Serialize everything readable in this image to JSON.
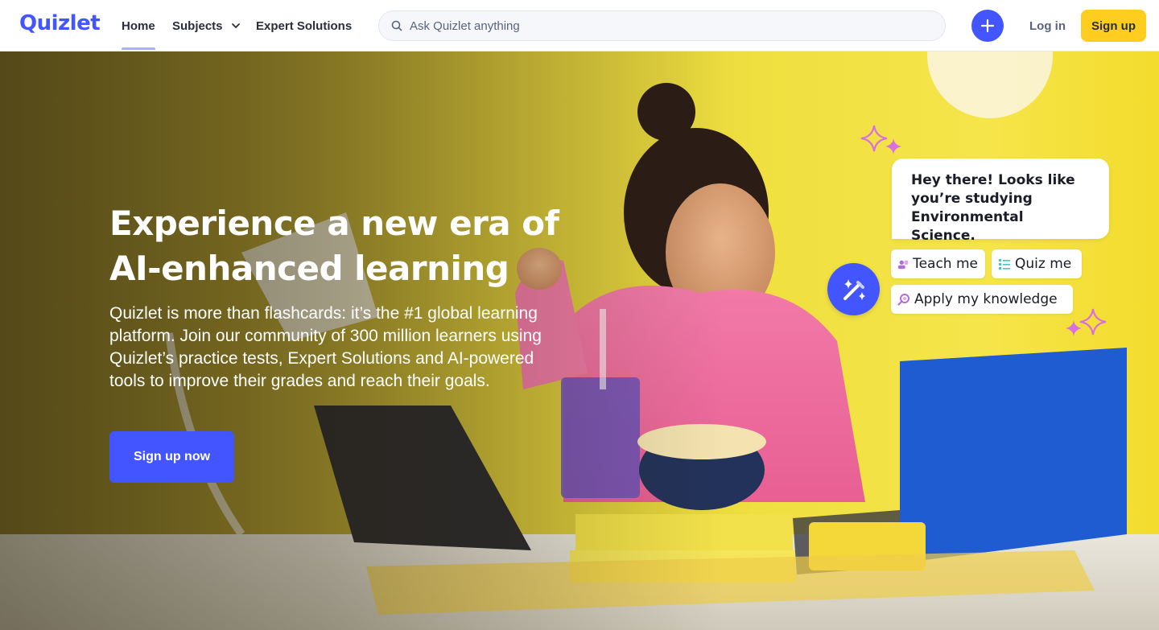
{
  "nav": {
    "logo": "Quizlet",
    "home": "Home",
    "subjects": "Subjects",
    "expert_solutions": "Expert Solutions",
    "search_placeholder": "Ask Quizlet anything",
    "login": "Log in",
    "signup": "Sign up"
  },
  "hero": {
    "headline_line1": "Experience a new era of",
    "headline_line2": "AI-enhanced learning",
    "subtext": "Quizlet is more than flashcards: it’s the #1 global learning platform. Join our community of 300 million learners using Quizlet’s practice tests, Expert Solutions and AI-powered tools to improve their grades and reach their goals.",
    "cta": "Sign up now"
  },
  "chat": {
    "message": "Hey there! Looks like you’re studying Environmental Science.",
    "chips": [
      "Teach me",
      "Quiz me",
      "Apply my knowledge"
    ]
  },
  "colors": {
    "brand": "#4255ff",
    "accent_yellow": "#ffcd1f",
    "sparkle": "#d96fe0"
  },
  "icons": [
    "search-icon",
    "chevron-down-icon",
    "plus-icon",
    "magic-wand-icon",
    "teach-icon",
    "quiz-icon",
    "apply-icon",
    "sparkle-icon"
  ]
}
